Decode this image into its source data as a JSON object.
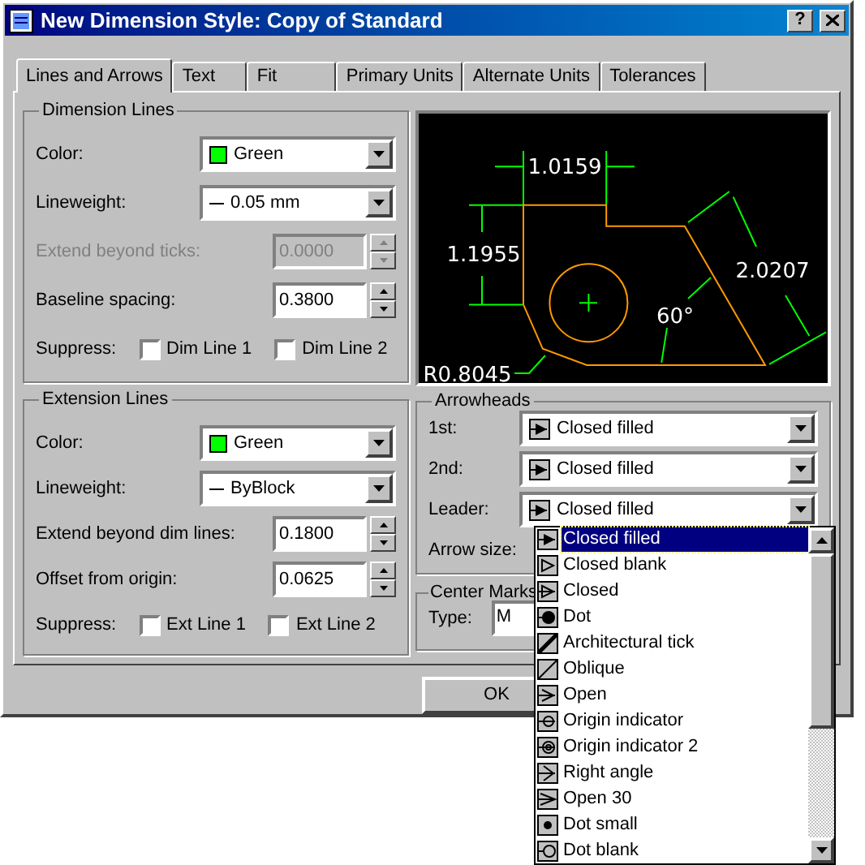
{
  "window": {
    "title": "New Dimension Style: Copy of Standard",
    "help": "?"
  },
  "tabs": [
    {
      "label": "Lines and Arrows",
      "selected": true
    },
    {
      "label": "Text",
      "selected": false
    },
    {
      "label": "Fit",
      "selected": false
    },
    {
      "label": "Primary Units",
      "selected": false
    },
    {
      "label": "Alternate Units",
      "selected": false
    },
    {
      "label": "Tolerances",
      "selected": false
    }
  ],
  "dimension_lines": {
    "title": "Dimension Lines",
    "rows": [
      {
        "kind": "combo",
        "label": "Color:",
        "value": "Green",
        "color": "#00ff00"
      },
      {
        "kind": "combo",
        "label": "Lineweight:",
        "value": "0.05 mm",
        "line": true
      },
      {
        "kind": "spin",
        "label": "Extend beyond ticks:",
        "value": "0.0000",
        "disabled": true
      },
      {
        "kind": "spin",
        "label": "Baseline spacing:",
        "value": "0.3800",
        "disabled": false
      },
      {
        "kind": "checks",
        "label": "Suppress:",
        "options": [
          {
            "label": "Dim Line 1",
            "checked": false
          },
          {
            "label": "Dim Line 2",
            "checked": false
          }
        ]
      }
    ]
  },
  "preview": {
    "labels": [
      "1.0159",
      "1.1955",
      "2.0207",
      "60°",
      "R0.8045"
    ]
  },
  "extension_lines": {
    "title": "Extension Lines",
    "rows": [
      {
        "kind": "combo",
        "label": "Color:",
        "value": "Green",
        "color": "#00ff00"
      },
      {
        "kind": "combo",
        "label": "Lineweight:",
        "value": "ByBlock",
        "line": true
      },
      {
        "kind": "spin",
        "label": "Extend beyond dim lines:",
        "value": "0.1800",
        "disabled": false
      },
      {
        "kind": "spin",
        "label": "Offset from origin:",
        "value": "0.0625",
        "disabled": false
      },
      {
        "kind": "checks",
        "label": "Suppress:",
        "options": [
          {
            "label": "Ext Line 1",
            "checked": false
          },
          {
            "label": "Ext Line 2",
            "checked": false
          }
        ]
      }
    ]
  },
  "arrowheads": {
    "title": "Arrowheads",
    "rows": [
      {
        "kind": "closed_filled",
        "label": "1st:",
        "value": "Closed filled"
      },
      {
        "kind": "closed_filled",
        "label": "2nd:",
        "value": "Closed filled"
      },
      {
        "kind": "closed_filled",
        "label": "Leader:",
        "value": "Closed filled"
      },
      {
        "kind": "label",
        "label": "Arrow size:"
      }
    ]
  },
  "center_marks": {
    "title": "Center Marks",
    "type_label": "Type:",
    "type_value": "M"
  },
  "dropdown": {
    "options": [
      {
        "label": "Closed filled",
        "kind": "closed_filled",
        "selected": true
      },
      {
        "label": "Closed blank",
        "kind": "closed_blank",
        "selected": false
      },
      {
        "label": "Closed",
        "kind": "closed",
        "selected": false
      },
      {
        "label": "Dot",
        "kind": "dot",
        "selected": false
      },
      {
        "label": "Architectural tick",
        "kind": "arch_tick",
        "selected": false
      },
      {
        "label": "Oblique",
        "kind": "oblique",
        "selected": false
      },
      {
        "label": "Open",
        "kind": "open",
        "selected": false
      },
      {
        "label": "Origin indicator",
        "kind": "origin",
        "selected": false
      },
      {
        "label": "Origin indicator 2",
        "kind": "origin2",
        "selected": false
      },
      {
        "label": "Right angle",
        "kind": "right_angle",
        "selected": false
      },
      {
        "label": "Open 30",
        "kind": "open30",
        "selected": false
      },
      {
        "label": "Dot small",
        "kind": "dot_small",
        "selected": false
      },
      {
        "label": "Dot blank",
        "kind": "dot_blank",
        "selected": false
      }
    ]
  },
  "buttons": [
    {
      "label": "OK"
    }
  ]
}
